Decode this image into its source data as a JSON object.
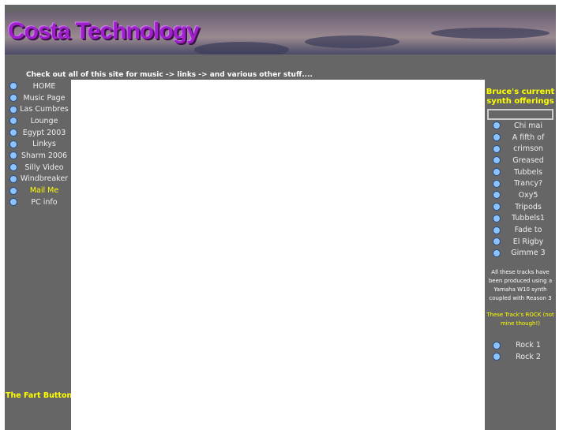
{
  "header": {
    "logo": "Costa Technology",
    "tagline": "Check out all of this site for music -> links -> and various other stuff...."
  },
  "left_nav": [
    {
      "label": "HOME"
    },
    {
      "label": "Music Page"
    },
    {
      "label": "Las Cumbres"
    },
    {
      "label": "Lounge"
    },
    {
      "label": "Egypt 2003"
    },
    {
      "label": "Linkys"
    },
    {
      "label": "Sharm 2006"
    },
    {
      "label": "Silly Video"
    },
    {
      "label": "Windbreaker"
    },
    {
      "label": "Mail Me"
    },
    {
      "label": "PC info"
    }
  ],
  "fart_button": "The Fart Button",
  "right": {
    "title": "Bruce's current synth offerings",
    "tracks": [
      "Chi mai",
      "A fifth of",
      "crimson",
      "Greased",
      "Tubbels",
      "Trancy?",
      "Oxy5",
      "Tripods",
      "Tubbels1",
      "Fade to",
      "El Rigby",
      "Gimme 3"
    ],
    "note": "All these tracks have been produced using a Yamaha W10 synth coupled with Reason 3",
    "rock_note": "These Track's ROCK (not mine though!)",
    "rock_tracks": [
      "Rock 1",
      "Rock 2"
    ]
  },
  "colors": {
    "background": "#666666",
    "highlight": "#ffff00",
    "bullet": "#8cc4ff",
    "logo": "#a020d0"
  }
}
